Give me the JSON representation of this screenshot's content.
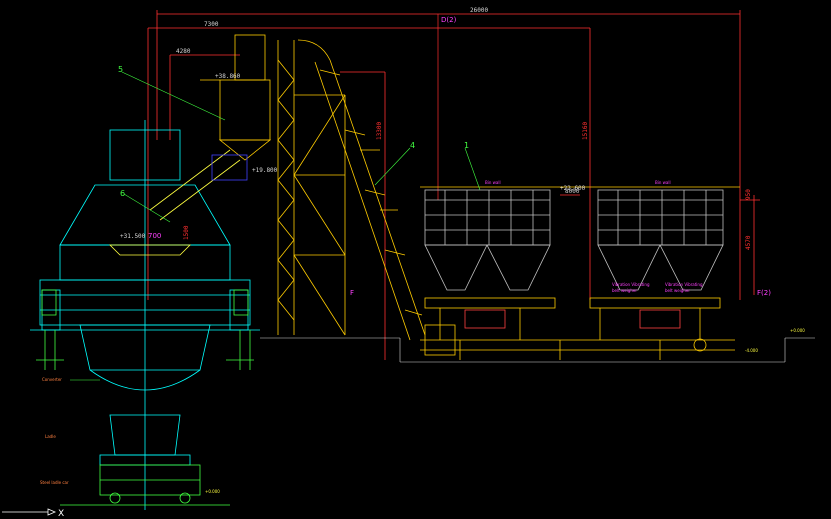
{
  "dimensions": {
    "d_2600": "26000",
    "d_7300": "7300",
    "d_4280": "4280",
    "d_13300": "13300",
    "d_15160": "15160",
    "d_8000": "8000",
    "d_4570": "4570",
    "d_950": "950",
    "d_700": "700",
    "d_1500": "1500"
  },
  "references": {
    "d2": "D(2)",
    "f2": "F(2)",
    "f1": "F"
  },
  "callouts": {
    "n1": "1",
    "n4": "4",
    "n5": "5",
    "n6": "6"
  },
  "labels": {
    "converter": "Converter",
    "ladle": "Ladle",
    "steel_ladle_car": "Steel ladle car",
    "bin_wall_left": "Bin wall",
    "bin_wall_right": "Bin wall",
    "vib_feeder_a": "Vibration Vibrating",
    "vib_feeder_b": "belt weigher",
    "vib_feeder_c": "Vibration Vibrating",
    "vib_feeder_d": "belt weigher"
  },
  "elevations": {
    "e_top": "+38.860",
    "e_hopper": "+31.500",
    "e_mid": "+19.800",
    "e_bin": "+22.600",
    "e_ground": "+0.000",
    "e_pit": "-4.000",
    "e_ladle": "+0.000"
  },
  "axis": {
    "x_label": "X"
  },
  "colors": {
    "background": "#000000",
    "converter": "#00ffff",
    "structure": "#ffcc00",
    "dimension": "#ff3030",
    "leader": "#40ff40"
  }
}
